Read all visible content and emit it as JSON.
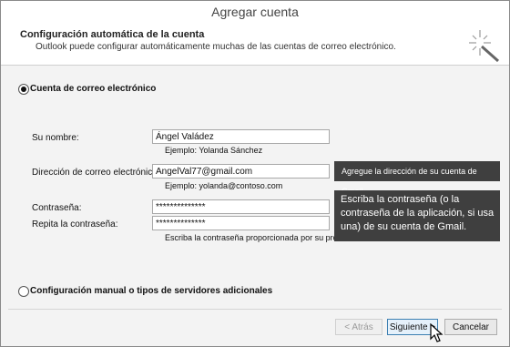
{
  "window": {
    "title": "Agregar cuenta"
  },
  "header": {
    "title": "Configuración automática de la cuenta",
    "subtitle": "Outlook puede configurar automáticamente muchas de las cuentas de correo electrónico."
  },
  "option_email": {
    "label": "Cuenta de correo electrónico",
    "selected": true
  },
  "fields": {
    "name": {
      "label": "Su nombre:",
      "value": "Ángel Valádez",
      "hint": "Ejemplo: Yolanda Sánchez"
    },
    "email": {
      "label": "Dirección de correo electrónico:",
      "value": "AngelVal77@gmail.com",
      "hint": "Ejemplo: yolanda@contoso.com"
    },
    "password": {
      "label": "Contraseña:",
      "value": "**************"
    },
    "password_repeat": {
      "label": "Repita la contraseña:",
      "value": "**************"
    },
    "password_hint": "Escriba la contraseña proporcionada por su pro"
  },
  "callouts": {
    "email": "Agregue la dirección de su cuenta de Gmail",
    "password": "Escriba la contraseña (o la contraseña de la aplicación, si usa una) de su cuenta de Gmail."
  },
  "option_manual": {
    "label": "Configuración manual o tipos de servidores adicionales",
    "selected": false
  },
  "buttons": {
    "back": "< Atrás",
    "next": "Siguiente >",
    "cancel": "Cancelar"
  },
  "icons": {
    "wand": "magic-wand-icon",
    "cursor": "mouse-pointer-icon"
  }
}
